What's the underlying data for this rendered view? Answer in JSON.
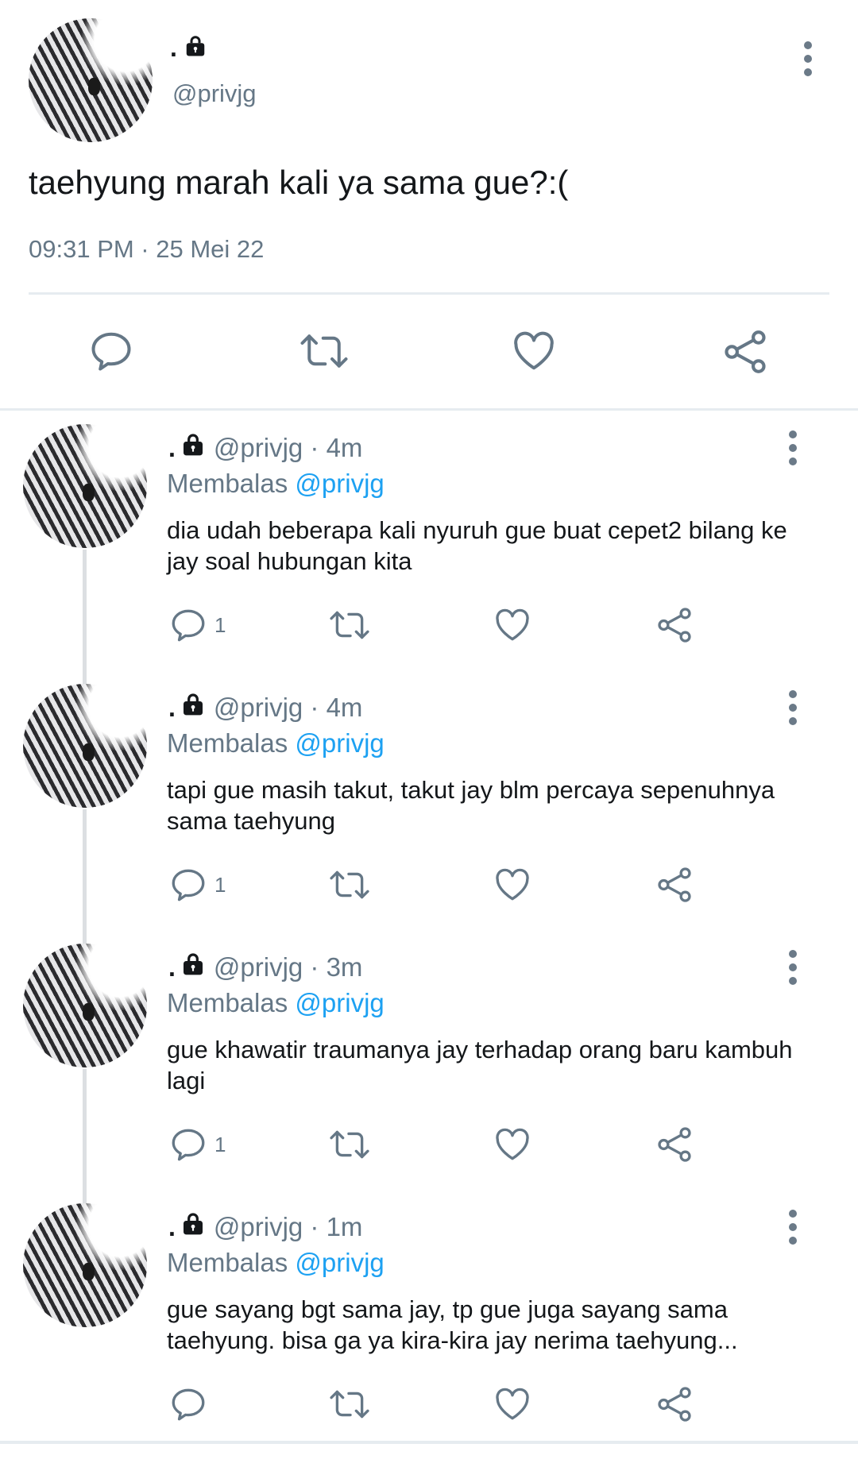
{
  "main_tweet": {
    "display_name": ".",
    "handle": "@privjg",
    "text": "taehyung marah kali ya sama gue?:(",
    "timestamp": "09:31 PM · 25 Mei 22",
    "icons": [
      "lock-icon",
      "more-vertical-icon",
      "reply-icon",
      "retweet-icon",
      "like-icon",
      "share-icon"
    ]
  },
  "replies": [
    {
      "display_name": ".",
      "handle_time": "@privjg · 4m",
      "replying_label": "Membalas",
      "replying_to": "@privjg",
      "text": "dia udah beberapa kali nyuruh gue buat cepet2 bilang ke jay soal hubungan kita",
      "reply_count": "1"
    },
    {
      "display_name": ".",
      "handle_time": "@privjg · 4m",
      "replying_label": "Membalas",
      "replying_to": "@privjg",
      "text": "tapi gue masih takut, takut jay blm percaya sepenuhnya sama taehyung",
      "reply_count": "1"
    },
    {
      "display_name": ".",
      "handle_time": "@privjg · 3m",
      "replying_label": "Membalas",
      "replying_to": "@privjg",
      "text": "gue khawatir traumanya jay terhadap orang baru kambuh lagi",
      "reply_count": "1"
    },
    {
      "display_name": ".",
      "handle_time": "@privjg · 1m",
      "replying_label": "Membalas",
      "replying_to": "@privjg",
      "text": "gue sayang bgt sama jay, tp gue juga sayang sama taehyung. bisa ga ya kira-kira jay nerima taehyung...",
      "reply_count": ""
    }
  ],
  "colors": {
    "text": "#14171a",
    "muted": "#657786",
    "link": "#1da1f2",
    "divider": "#e6ecf0"
  }
}
